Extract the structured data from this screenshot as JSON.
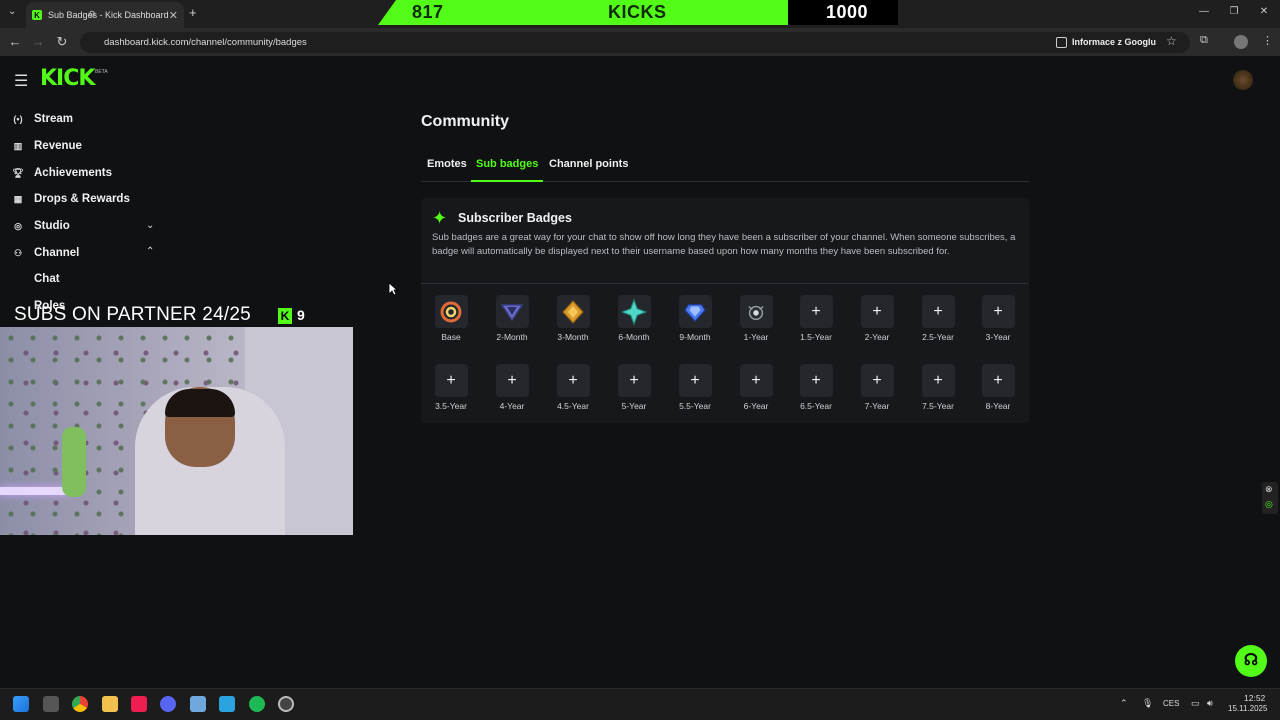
{
  "browser": {
    "tab_title": "Sub Badges - Kick Dashboard",
    "tab_favicon": "K",
    "url": "dashboard.kick.com/channel/community/badges",
    "info_chip": "Informace z Googlu"
  },
  "overlay_bar": {
    "left_value": "817",
    "label": "KICKS",
    "goal": "1000"
  },
  "app": {
    "logo": "KICK",
    "logo_badge": "BETA"
  },
  "sidebar": {
    "items": [
      {
        "label": "Stream",
        "icon": "broadcast-icon"
      },
      {
        "label": "Revenue",
        "icon": "revenue-icon"
      },
      {
        "label": "Achievements",
        "icon": "trophy-icon"
      },
      {
        "label": "Drops & Rewards",
        "icon": "gift-icon"
      },
      {
        "label": "Studio",
        "icon": "studio-icon"
      },
      {
        "label": "Channel",
        "icon": "channel-icon"
      }
    ],
    "channel_sub": [
      "Chat",
      "Roles"
    ]
  },
  "main": {
    "title": "Community",
    "tabs": [
      "Emotes",
      "Sub badges",
      "Channel points"
    ],
    "active_tab": "Sub badges",
    "panel": {
      "title": "Subscriber Badges",
      "description": "Sub badges are a great way for your chat to show off how long they have been a subscriber of your channel. When someone subscribes, a badge will automatically be displayed next to their username based upon how many months they have been subscribed for.",
      "badges_row1": [
        {
          "label": "Base",
          "icon": "base-badge-icon"
        },
        {
          "label": "2-Month",
          "icon": "2-month-badge-icon"
        },
        {
          "label": "3-Month",
          "icon": "3-month-badge-icon"
        },
        {
          "label": "6-Month",
          "icon": "6-month-badge-icon"
        },
        {
          "label": "9-Month",
          "icon": "9-month-badge-icon"
        },
        {
          "label": "1-Year",
          "icon": "1-year-badge-icon"
        },
        {
          "label": "1.5-Year",
          "icon": "plus-icon"
        },
        {
          "label": "2-Year",
          "icon": "plus-icon"
        },
        {
          "label": "2.5-Year",
          "icon": "plus-icon"
        },
        {
          "label": "3-Year",
          "icon": "plus-icon"
        }
      ],
      "badges_row2": [
        {
          "label": "3.5-Year",
          "icon": "plus-icon"
        },
        {
          "label": "4-Year",
          "icon": "plus-icon"
        },
        {
          "label": "4.5-Year",
          "icon": "plus-icon"
        },
        {
          "label": "5-Year",
          "icon": "plus-icon"
        },
        {
          "label": "5.5-Year",
          "icon": "plus-icon"
        },
        {
          "label": "6-Year",
          "icon": "plus-icon"
        },
        {
          "label": "6.5-Year",
          "icon": "plus-icon"
        },
        {
          "label": "7-Year",
          "icon": "plus-icon"
        },
        {
          "label": "7.5-Year",
          "icon": "plus-icon"
        },
        {
          "label": "8-Year",
          "icon": "plus-icon"
        }
      ]
    }
  },
  "stream_overlay": {
    "subs_text": "SUBS ON PARTNER 24/25",
    "k_count": "9"
  },
  "taskbar": {
    "language": "CES",
    "time": "12:52",
    "date": "15.11.2025"
  },
  "colors": {
    "accent": "#53fc18",
    "background": "#0f1113",
    "panel": "#16181b"
  }
}
